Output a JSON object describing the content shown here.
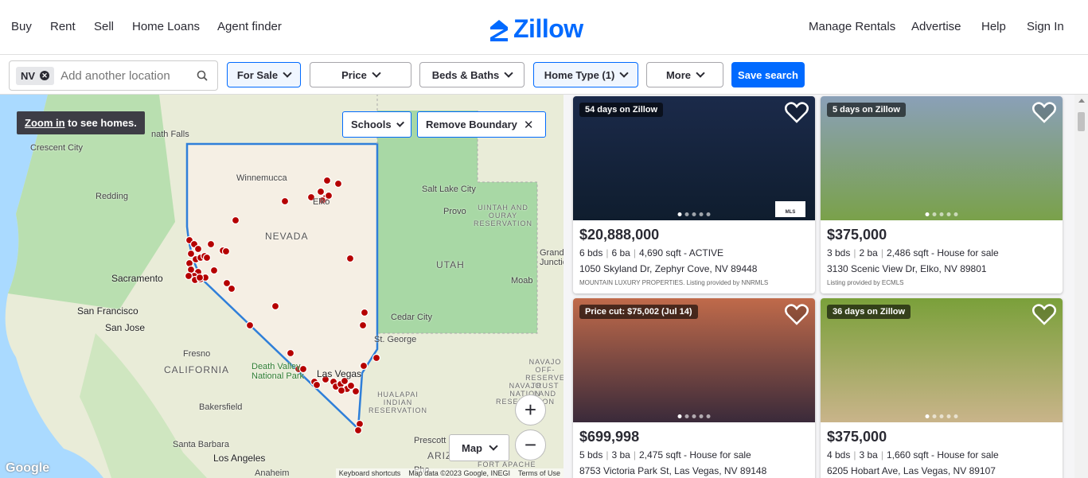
{
  "header": {
    "nav_left": [
      "Buy",
      "Rent",
      "Sell",
      "Home Loans",
      "Agent finder"
    ],
    "logo": "Zillow",
    "nav_right": [
      "Manage Rentals",
      "Advertise",
      "Help",
      "Sign In"
    ]
  },
  "filters": {
    "location_chip": "NV",
    "search_placeholder": "Add another location",
    "for_sale": "For Sale",
    "price": "Price",
    "beds_baths": "Beds & Baths",
    "home_type": "Home Type (1)",
    "more": "More",
    "save_search": "Save search"
  },
  "map": {
    "zoom_tip_link": "Zoom in",
    "zoom_tip_rest": " to see homes.",
    "schools": "Schools",
    "remove_boundary": "Remove Boundary",
    "map_type": "Map",
    "attribution": {
      "shortcuts": "Keyboard shortcuts",
      "data": "Map data ©2023 Google, INEGI",
      "terms": "Terms of Use"
    },
    "google": "Google",
    "labels": [
      "Crescent City",
      "nath Falls",
      "Redding",
      "Winnemucca",
      "Elko",
      "Salt Lake City",
      "Provo",
      "UINTAH AND OURAY RESERVATION",
      "NEVADA",
      "UTAH",
      "Sacramento",
      "San Francisco",
      "San Jose",
      "Fresno",
      "CALIFORNIA",
      "Death Valley National Park",
      "Las Vegas",
      "St. George",
      "Cedar City",
      "Moab",
      "Grand Junction",
      "HUALAPAI INDIAN RESERVATION",
      "NAVAJO OFF-RESERVE TRUST LAND",
      "NAVAJO NATION RESERVATION",
      "Bakersfield",
      "Santa Barbara",
      "Los Angeles",
      "Anaheim",
      "Prescott",
      "ARIZ",
      "FORT APACHE",
      "Pho"
    ]
  },
  "listings": [
    {
      "badge": "54 days on Zillow",
      "price": "$20,888,000",
      "beds": "6 bds",
      "baths": "6 ba",
      "sqft": "4,690 sqft",
      "status": "- ACTIVE",
      "address": "1050 Skyland Dr, Zephyr Cove, NV 89448",
      "provider": "MOUNTAIN LUXURY PROPERTIES. Listing provided by NNRMLS",
      "mls": "MLS",
      "colors": [
        "#1b2a4a",
        "#0f1d2e"
      ]
    },
    {
      "badge": "5 days on Zillow",
      "price": "$375,000",
      "beds": "3 bds",
      "baths": "2 ba",
      "sqft": "2,486 sqft",
      "status": "- House for sale",
      "address": "3130 Scenic View Dr, Elko, NV 89801",
      "provider": "Listing provided by ECMLS",
      "colors": [
        "#8aa0b8",
        "#7aa14a"
      ]
    },
    {
      "badge": "Price cut: $75,002 (Jul 14)",
      "price": "$699,998",
      "beds": "5 bds",
      "baths": "3 ba",
      "sqft": "2,475 sqft",
      "status": "- House for sale",
      "address": "8753 Victoria Park St, Las Vegas, NV 89148",
      "colors": [
        "#c06a4a",
        "#3a2a3a"
      ]
    },
    {
      "badge": "36 days on Zillow",
      "price": "$375,000",
      "beds": "4 bds",
      "baths": "3 ba",
      "sqft": "1,660 sqft",
      "status": "- House for sale",
      "address": "6205 Hobart Ave, Las Vegas, NV 89107",
      "colors": [
        "#7aa03a",
        "#c9b48a"
      ]
    }
  ],
  "colors": {
    "brand": "#006aff",
    "pin": "#b50000"
  }
}
